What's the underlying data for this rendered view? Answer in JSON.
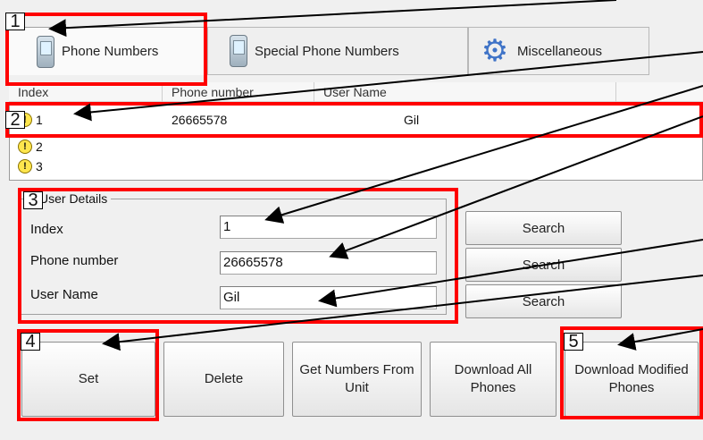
{
  "tabs": [
    {
      "label": "Phone Numbers",
      "icon": "phone-icon",
      "active": true
    },
    {
      "label": "Special Phone Numbers",
      "icon": "phone-icon",
      "active": false
    },
    {
      "label": "Miscellaneous",
      "icon": "gear-icon",
      "active": false
    }
  ],
  "table": {
    "columns": [
      "Index",
      "Phone number",
      "User Name"
    ],
    "rows": [
      {
        "index": "1",
        "phone": "26665578",
        "name": "Gil"
      },
      {
        "index": "2",
        "phone": "",
        "name": ""
      },
      {
        "index": "3",
        "phone": "",
        "name": ""
      }
    ]
  },
  "details": {
    "title": "User Details",
    "index_label": "Index",
    "phone_label": "Phone number",
    "name_label": "User Name",
    "index_value": "1",
    "phone_value": "26665578",
    "name_value": "Gil"
  },
  "search_label": "Search",
  "actions": {
    "set": "Set",
    "delete": "Delete",
    "get_numbers": "Get Numbers From Unit",
    "download_all": "Download All Phones",
    "download_modified": "Download Modified Phones"
  },
  "callouts": [
    "1",
    "2",
    "3",
    "4",
    "5"
  ],
  "colors": {
    "annotation": "#ff0000",
    "warning": "#ffe64d"
  }
}
